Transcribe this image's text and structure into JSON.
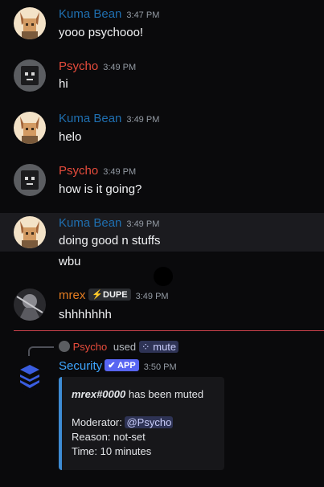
{
  "messages": [
    {
      "author": "Kuma Bean",
      "time": "3:47 PM",
      "lines": [
        "yooo psychooo!"
      ],
      "color": "#1f6fb0"
    },
    {
      "author": "Psycho",
      "time": "3:49 PM",
      "lines": [
        "hi"
      ],
      "color": "#e74c3c"
    },
    {
      "author": "Kuma Bean",
      "time": "3:49 PM",
      "lines": [
        "helo"
      ],
      "color": "#1f6fb0"
    },
    {
      "author": "Psycho",
      "time": "3:49 PM",
      "lines": [
        "how is it going?"
      ],
      "color": "#e74c3c"
    },
    {
      "author": "Kuma Bean",
      "time": "3:49 PM",
      "lines": [
        "doing good n stuffs",
        "wbu"
      ],
      "color": "#1f6fb0"
    },
    {
      "author": "mrex",
      "badge": "DUPE",
      "time": "3:49 PM",
      "lines": [
        "shhhhhhh"
      ],
      "color": "#e67e22"
    }
  ],
  "interaction": {
    "user": "Psycho",
    "verb": "used",
    "command": "mute"
  },
  "bot_message": {
    "author": "Security",
    "badge": "APP",
    "time": "3:50 PM",
    "author_color": "#3ea6ff",
    "embed": {
      "target_user": "mrex#0000",
      "action_text": " has been muted",
      "moderator_label": "Moderator: ",
      "moderator_mention": "@Psycho",
      "reason": "Reason: not-set",
      "duration": "Time: 10 minutes",
      "accent_color": "#3e8cd4"
    }
  },
  "icons": {
    "badge_icon": "lightning-icon",
    "command_icon": "slash-command-icon",
    "app_icon": "checkmark-icon",
    "bot_avatar": "shield-layers-icon"
  }
}
